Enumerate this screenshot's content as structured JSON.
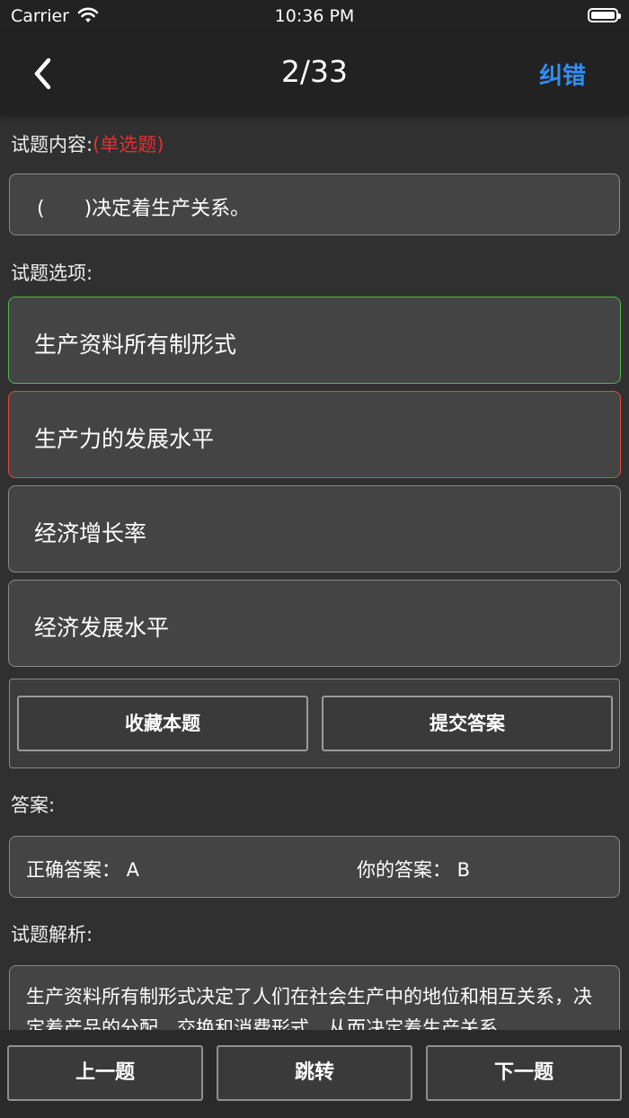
{
  "status_bar": {
    "carrier": "Carrier",
    "time": "10:36 PM"
  },
  "nav": {
    "progress": "2/33",
    "correct_label": "纠错",
    "accent": "#2f8ff5"
  },
  "question": {
    "label": "试题内容:",
    "type": "(单选题)",
    "text": "(　　)决定着生产关系。"
  },
  "options_label": "试题选项:",
  "options": [
    {
      "text": "生产资料所有制形式",
      "state": "correct"
    },
    {
      "text": "生产力的发展水平",
      "state": "wrong"
    },
    {
      "text": "经济增长率",
      "state": "none"
    },
    {
      "text": "经济发展水平",
      "state": "none"
    }
  ],
  "actions": {
    "favorite": "收藏本题",
    "submit": "提交答案"
  },
  "answer": {
    "label": "答案:",
    "correct_text": "正确答案：  A",
    "yours_text": "你的答案：  B"
  },
  "analysis": {
    "label": "试题解析:",
    "text": "生产资料所有制形式决定了人们在社会生产中的地位和相互关系，决定着产品的分配、交换和消费形式，从而决定着生产关系。"
  },
  "bottom": {
    "prev": "上一题",
    "jump": "跳转",
    "next": "下一题"
  },
  "colors": {
    "correct_border": "#4cb84c",
    "wrong_border": "#e24b3b",
    "type_text": "#e03030"
  }
}
